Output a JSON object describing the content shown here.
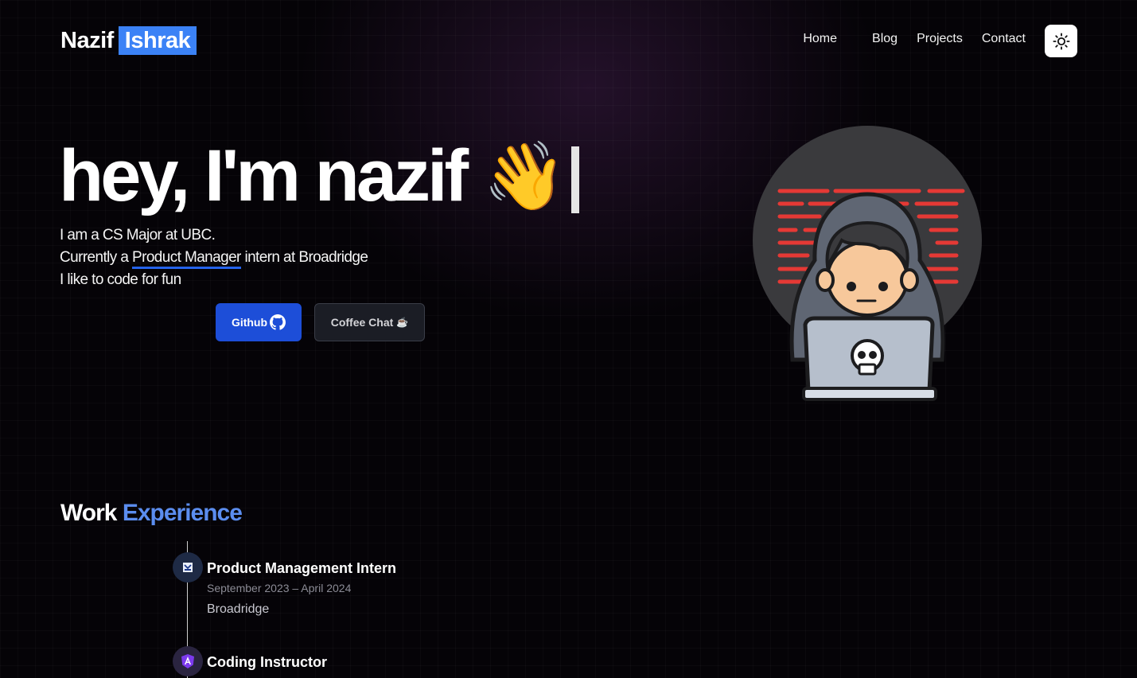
{
  "header": {
    "logo_first": "Nazif",
    "logo_second": "Ishrak",
    "nav": [
      "Home",
      "Blog",
      "Projects",
      "Contact"
    ],
    "theme_toggle_icon": "sun-icon"
  },
  "hero": {
    "title": "hey, I'm nazif",
    "emoji": "👋",
    "line1": "I am a CS Major at UBC.",
    "line2_prefix": "Currently a ",
    "line2_highlight": "Product Manager",
    "line2_suffix": " intern at Broadridge",
    "line3": "I like to code for fun",
    "github_label": "Github",
    "coffee_label": "Coffee Chat",
    "coffee_emoji": "☕"
  },
  "work": {
    "title_plain": "Work",
    "title_accent": "Experience",
    "jobs": [
      {
        "title": "Product Management Intern",
        "dates": "September 2023 – April 2024",
        "company": "Broadridge",
        "icon": "broadridge-logo-icon"
      },
      {
        "title": "Coding Instructor",
        "icon": "angular-logo-icon"
      }
    ]
  },
  "colors": {
    "accent": "#3b82f6",
    "github_button": "#1d4ed8",
    "section_accent": "#5b8def"
  }
}
